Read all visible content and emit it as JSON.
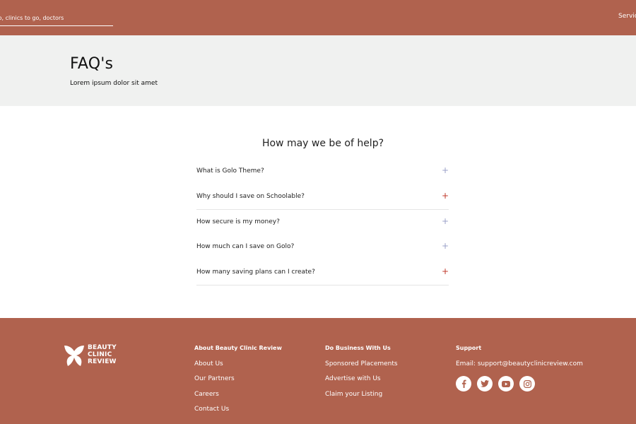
{
  "header": {
    "search_placeholder": "Find services to do, clinics to go, doctors...",
    "nav_label": "Services"
  },
  "hero": {
    "title": "FAQ's",
    "subtitle": "Lorem ipsum dolor sit amet"
  },
  "faq": {
    "heading": "How may we be of help?",
    "items": [
      {
        "question": "What is Golo Theme?",
        "icon": "plus-icon",
        "active": false
      },
      {
        "question": "Why should I save on Schoolable?",
        "icon": "plus-icon",
        "active": true
      },
      {
        "question": "How secure is my money?",
        "icon": "plus-icon",
        "active": false
      },
      {
        "question": "How much can I save on Golo?",
        "icon": "plus-icon",
        "active": false
      },
      {
        "question": "How many saving plans can I create?",
        "icon": "plus-icon",
        "active": true
      }
    ]
  },
  "footer": {
    "logo": {
      "line1": "BEAUTY",
      "line2": "CLINIC",
      "line3": "REVIEW",
      "icon": "butterfly-logo-icon"
    },
    "about": {
      "heading": "About Beauty Clinic Review",
      "links": [
        "About Us",
        "Our Partners",
        "Careers",
        "Contact Us"
      ]
    },
    "business": {
      "heading": "Do Business With Us",
      "links": [
        "Sponsored Placements",
        "Advertise with Us",
        "Claim your Listing"
      ]
    },
    "support": {
      "heading": "Support",
      "email": "Email: support@beautyclinicreview.com",
      "socials": [
        "facebook-icon",
        "twitter-icon",
        "youtube-icon",
        "instagram-icon"
      ]
    }
  },
  "colors": {
    "brand": "#b0624e",
    "hero_bg": "#f0f1f0",
    "plus_inactive": "#9aa0c8",
    "plus_active": "#c0392b"
  }
}
